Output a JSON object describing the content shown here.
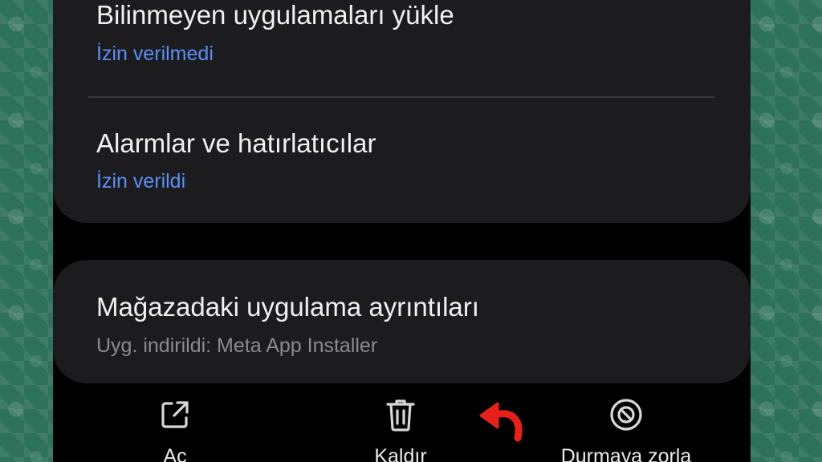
{
  "settings": {
    "install_unknown": {
      "title": "Bilinmeyen uygulamaları yükle",
      "status": "İzin verilmedi"
    },
    "alarms": {
      "title": "Alarmlar ve hatırlatıcılar",
      "status": "İzin verildi"
    },
    "store_details": {
      "title": "Mağazadaki uygulama ayrıntıları",
      "subtitle": "Uyg. indirildi: Meta App Installer"
    }
  },
  "actions": {
    "open_label": "Aç",
    "uninstall_label": "Kaldır",
    "force_stop_label": "Durmaya zorla"
  },
  "icons": {
    "open": "open-external-icon",
    "uninstall": "trash-icon",
    "force_stop": "block-icon",
    "annotation": "red-curved-arrow-icon"
  },
  "colors": {
    "background": "#000000",
    "card": "#1c1c1e",
    "accent_blue": "#5b8ff5",
    "secondary_gray": "#8c8c8f",
    "annotation_red": "#e8201a",
    "wallpaper_green": "#2f725c"
  }
}
